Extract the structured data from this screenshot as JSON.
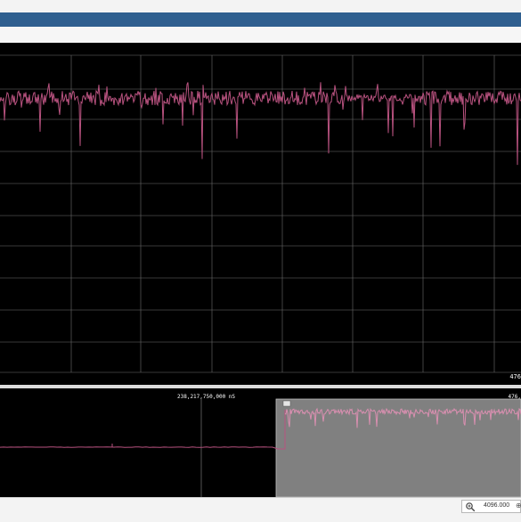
{
  "main_plot": {
    "right_label": "476"
  },
  "overview": {
    "center_time": "238,217,750,000 nS",
    "right_label": "476,",
    "handle_icon": "selection-handle-icon"
  },
  "bottom": {
    "zoom_icon": "magnifier-icon",
    "zoom_value": "4096.000",
    "zoom_extra": "⊕"
  },
  "colors": {
    "trace": "#b8527f",
    "overview_trace": "#d98fb0",
    "grid": "#3a3a3a",
    "window_band": "#2f5f8f"
  }
}
